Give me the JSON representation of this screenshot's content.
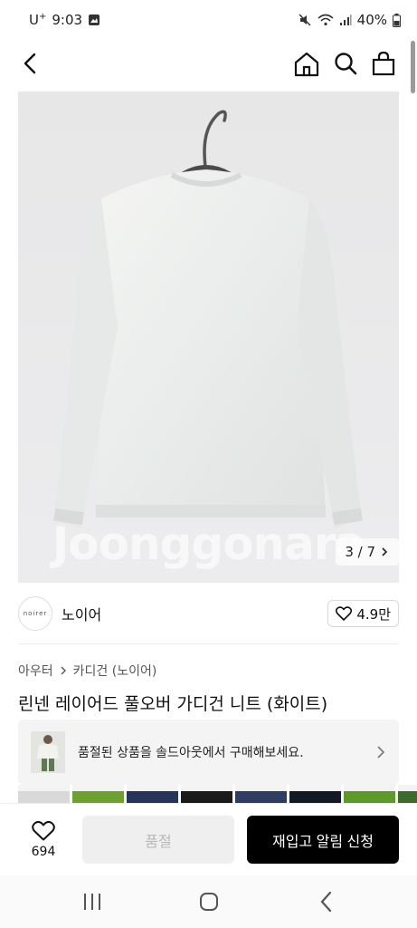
{
  "status": {
    "carrier": "U",
    "carrier_sup": "+",
    "time": "9:03",
    "battery": "40%"
  },
  "nav": {
    "back": "back-icon",
    "home": "home-icon",
    "search": "search-icon",
    "bag": "shopping-bag-icon"
  },
  "gallery": {
    "watermark": "Joonggonara",
    "counter": "3 / 7",
    "current_index": 3,
    "total": 7
  },
  "brand": {
    "logo_text": "noirer",
    "name": "노이어",
    "likes": "4.9만"
  },
  "breadcrumb": {
    "level1": "아우터",
    "level2": "카디건 (노이어)"
  },
  "product": {
    "title": "린넨 레이어드 풀오버 가디건 니트 (화이트)"
  },
  "soldout_banner": {
    "text": "품절된 상품을 솔드아웃에서 구매해보세요."
  },
  "swatch_colors": [
    "#d9d9d9",
    "#6ea12f",
    "#26335a",
    "#1a1a1a",
    "#2f3d63",
    "#141a25",
    "#5c9a2a",
    "#3b6c2c",
    "#bfbfbf"
  ],
  "bottom": {
    "wish_count": "694",
    "soldout_label": "품절",
    "restock_label": "재입고 알림 신청"
  },
  "colors": {
    "primary_button": "#000000",
    "disabled_button": "#efefef"
  }
}
